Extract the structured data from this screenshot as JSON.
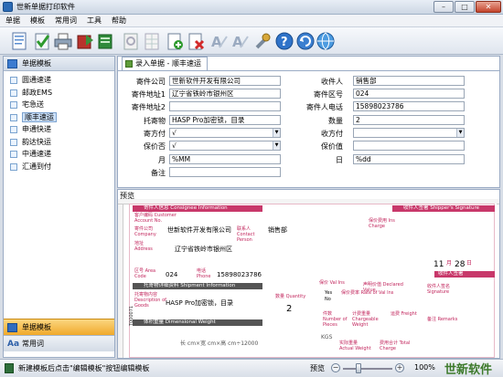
{
  "window": {
    "title": "世新单据打印软件",
    "minimize": "–",
    "maximize": "□",
    "close": "✕"
  },
  "menu": [
    "单据",
    "模板",
    "常用词",
    "工具",
    "帮助"
  ],
  "toolbar_icons": [
    "new-icon",
    "check-icon",
    "print-icon",
    "export-icon",
    "import-icon",
    "settings-icon",
    "grid-icon",
    "add-icon",
    "delete-icon",
    "font-a-icon",
    "font-b-icon",
    "wrench-icon",
    "help-icon",
    "refresh-icon",
    "globe-icon"
  ],
  "sidebar": {
    "header": "单据模板",
    "items": [
      "圆通速递",
      "邮政EMS",
      "宅急送",
      "顺丰速运",
      "申通快递",
      "韵达快运",
      "中通速递",
      "汇通到付"
    ],
    "selected_index": 3,
    "bottom_active": "单据模板",
    "bottom_other": "常用词"
  },
  "tab": {
    "label": "录入单据 - 顺丰速运"
  },
  "form_left": [
    {
      "label": "寄件公司",
      "value": "世新软件开发有限公司"
    },
    {
      "label": "寄件地址1",
      "value": "辽宁省铁岭市银州区"
    },
    {
      "label": "寄件地址2",
      "value": ""
    },
    {
      "label": "托寄物",
      "value": "HASP Pro加密锁，目录"
    },
    {
      "label": "寄方付",
      "value": "√"
    },
    {
      "label": "保价否",
      "value": "√"
    },
    {
      "label": "月",
      "value": "%MM"
    },
    {
      "label": "备注",
      "value": ""
    }
  ],
  "form_right": [
    {
      "label": "收件人",
      "value": "销售部"
    },
    {
      "label": "寄件区号",
      "value": "024"
    },
    {
      "label": "寄件人电话",
      "value": "15898023786"
    },
    {
      "label": "数量",
      "value": "2"
    },
    {
      "label": "收方付",
      "value": ""
    },
    {
      "label": "保价值",
      "value": ""
    },
    {
      "label": "日",
      "value": "%dd"
    }
  ],
  "preview": {
    "label": "预览",
    "sender_band": "寄件人信息 Consignee Information",
    "customer_code": "客户编码 Customer Account No.",
    "company_label": "寄件公司 Company",
    "company_value": "世新软件开发有限公司",
    "contact_label": "联系人 Contact Person",
    "contact_value": "销售部",
    "address_label": "地址 Address",
    "address_value": "辽宁省铁岭市银州区",
    "area_label": "区号 Area Code",
    "area_value": "024",
    "phone_label": "电话 Phone",
    "phone_value": "15898023786",
    "shipment_band": "托寄物详细资料 Shipment Information",
    "goods_label": "托寄物内容 Description of Goods",
    "goods_value": "HASP Pro加密锁，目录",
    "qty_label": "数量 Quantity",
    "qty_value": "2",
    "weight_band": "体积重量 Dimensional Weight",
    "weight_formula": "长 cm×宽 cm×高 cm÷12000",
    "kgs": "KGS",
    "right_band": "收件人签署 Shipper's Signature",
    "date_day": "11",
    "date_month": "28",
    "date_suffix": "日",
    "date_month_suffix": "月",
    "consignee_band": "收件人签署 Consignee's Signature",
    "receiver_label": "收件人签名 Signature",
    "remarks": "备注 Remarks",
    "checkbox_yes": "Yes",
    "checkbox_no": "No",
    "insurance_label": "保价 Val Ins",
    "insurance_fee": "保价费用 Ins Charge",
    "declared_value": "声明价值 Declared Value",
    "rate_label": "保价费率 Rate of Val Ins",
    "pieces_label": "件数 Number of Pieces",
    "charge_weight": "计费重量 Chargeable Weight",
    "freight": "运费 Freight",
    "actual_weight": "实际重量 Actual Weight",
    "cost_total": "费用合计 Total Charge",
    "serial": "T000071"
  },
  "status": {
    "text": "新建模板后点击\"编辑模板\"按钮编辑模板",
    "zoom_label": "预览",
    "zoom": "100%",
    "brand": "世新软件"
  }
}
